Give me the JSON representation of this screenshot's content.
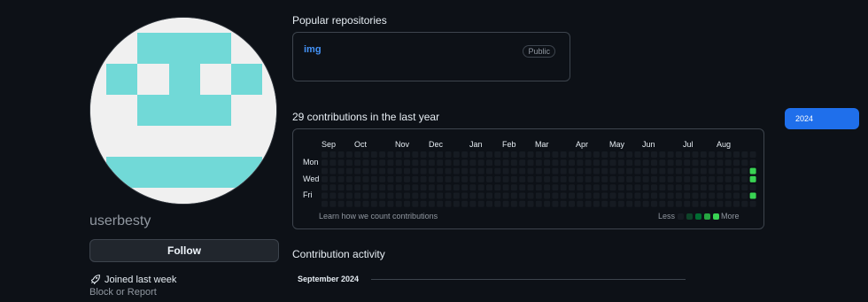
{
  "profile": {
    "username": "userbesty",
    "follow_label": "Follow",
    "joined_text": "Joined last week",
    "block_label": "Block or Report"
  },
  "popular": {
    "heading": "Popular repositories",
    "repos": [
      {
        "name": "img",
        "visibility": "Public"
      }
    ]
  },
  "contributions": {
    "heading": "29 contributions in the last year",
    "months": [
      "Sep",
      "Oct",
      "Nov",
      "Dec",
      "Jan",
      "Feb",
      "Mar",
      "Apr",
      "May",
      "Jun",
      "Jul",
      "Aug"
    ],
    "days": [
      "Mon",
      "Wed",
      "Fri"
    ],
    "learn_text": "Learn how we count contributions",
    "legend_less": "Less",
    "legend_more": "More",
    "colors": {
      "empty": "#161b22",
      "level1": "#0e4429",
      "level2": "#006d32",
      "level3": "#26a641",
      "level4": "#39d353"
    }
  },
  "year_selector": {
    "selected": "2024"
  },
  "activity": {
    "heading": "Contribution activity",
    "month": "September 2024"
  },
  "colors": {
    "accent": "#1f6feb",
    "link": "#4493f8",
    "avatar_fill": "#71d9d7"
  }
}
